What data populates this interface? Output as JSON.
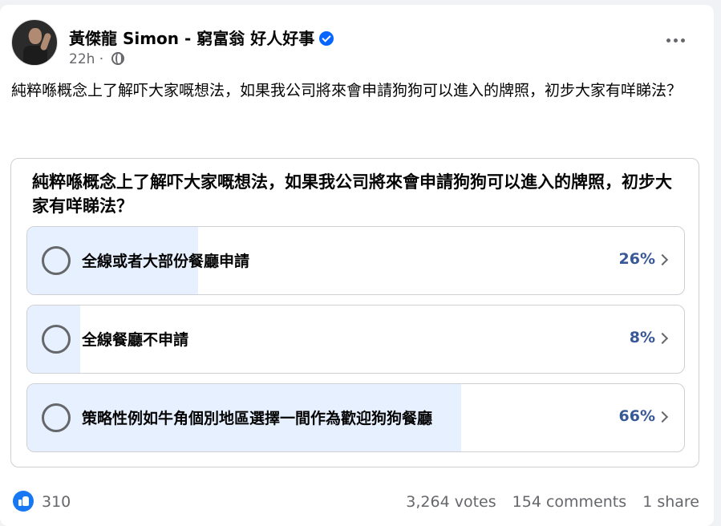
{
  "post": {
    "author": "黃傑龍 Simon - 窮富翁 好人好事",
    "time": "22h",
    "text": "純粹喺概念上了解吓大家嘅想法，如果我公司將來會申請狗狗可以進入的牌照，初步大家有咩睇法？"
  },
  "poll": {
    "question": "純粹喺概念上了解吓大家嘅想法，如果我公司將來會申請狗狗可以進入的牌照，初步大家有咩睇法？",
    "options": [
      {
        "label": "全線或者大部份餐廳申請",
        "percent": "26%",
        "fraction": 0.26
      },
      {
        "label": "全線餐廳不申請",
        "percent": "8%",
        "fraction": 0.08
      },
      {
        "label": "策略性例如牛角個別地區選擇一間作為歡迎狗狗餐廳",
        "percent": "66%",
        "fraction": 0.66
      }
    ]
  },
  "footer": {
    "reactions": "310",
    "votes": "3,264 votes",
    "comments": "154 comments",
    "shares": "1 share"
  },
  "icons": [
    "verified-icon",
    "globe-icon",
    "more-icon",
    "chevron-right-icon",
    "like-icon"
  ],
  "colors": {
    "accent": "#1877f2",
    "fill": "#e7f0fe",
    "percent": "#385898"
  }
}
